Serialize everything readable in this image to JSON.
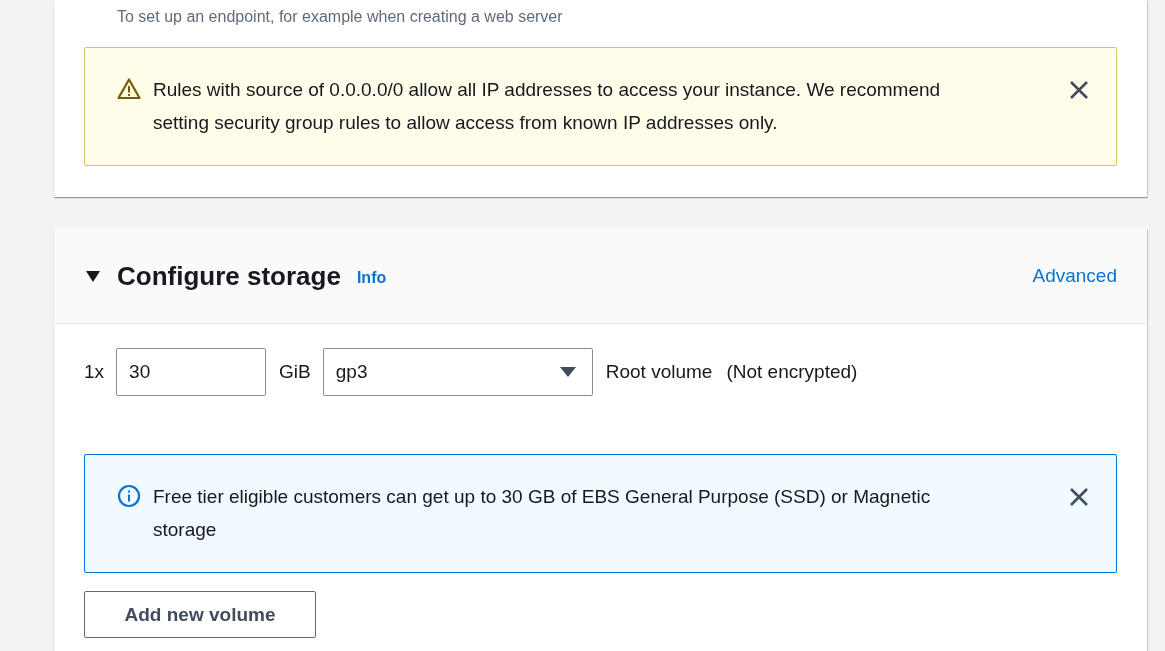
{
  "network_card": {
    "endpoint_hint": "To set up an endpoint, for example when creating a web server",
    "alert": {
      "kind": "warning",
      "text": "Rules with source of 0.0.0.0/0 allow all IP addresses to access your instance. We recommend setting security group rules to allow access from known IP addresses only."
    }
  },
  "storage": {
    "expanded": true,
    "title": "Configure storage",
    "info_link": "Info",
    "advanced_link": "Advanced",
    "volume": {
      "count": "1x",
      "size": "30",
      "unit": "GiB",
      "type": "gp3",
      "label": "Root volume",
      "encryption": "(Not encrypted)"
    },
    "alert": {
      "kind": "info",
      "text": "Free tier eligible customers can get up to 30 GB of EBS General Purpose (SSD) or Magnetic storage"
    },
    "add_button": "Add new volume"
  }
}
